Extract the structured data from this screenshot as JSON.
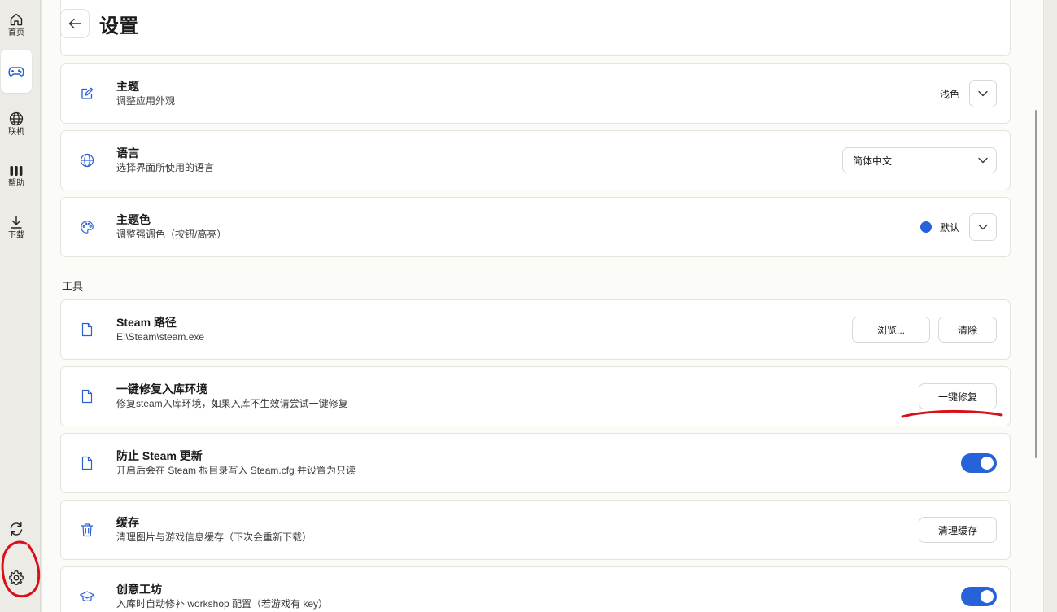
{
  "sidebar": {
    "items": [
      {
        "label": "首页",
        "icon": "home-icon"
      },
      {
        "label": "",
        "icon": "gamepad-icon",
        "active": true
      },
      {
        "label": "联机",
        "icon": "globe-icon"
      },
      {
        "label": "帮助",
        "icon": "help-bars-icon"
      },
      {
        "label": "下载",
        "icon": "download-icon"
      }
    ],
    "bottom": [
      {
        "icon": "sync-icon"
      },
      {
        "icon": "gear-icon"
      }
    ]
  },
  "header": {
    "title": "设置"
  },
  "appearance": {
    "theme": {
      "title": "主题",
      "desc": "调整应用外观",
      "value": "浅色"
    },
    "language": {
      "title": "语言",
      "desc": "选择界面所使用的语言",
      "value": "简体中文"
    },
    "accent": {
      "title": "主题色",
      "desc": "调整强调色（按钮/高亮）",
      "value": "默认",
      "color": "#2662d9"
    }
  },
  "tools": {
    "section_label": "工具",
    "steam_path": {
      "title": "Steam 路径",
      "desc": "E:\\Steam\\steam.exe",
      "browse_label": "浏览...",
      "clear_label": "清除"
    },
    "repair": {
      "title": "一键修复入库环境",
      "desc": "修复steam入库环境，如果入库不生效请尝试一键修复",
      "button_label": "一键修复"
    },
    "block_update": {
      "title": "防止 Steam 更新",
      "desc": "开启后会在 Steam 根目录写入 Steam.cfg 并设置为只读",
      "enabled": true
    },
    "cache": {
      "title": "缓存",
      "desc": "清理图片与游戏信息缓存（下次会重新下载）",
      "button_label": "清理缓存"
    },
    "workshop": {
      "title": "创意工坊",
      "desc": "入库时自动修补 workshop 配置（若游戏有 key）",
      "enabled": true
    }
  },
  "colors": {
    "accent": "#2763d8",
    "annotation": "#d9101a"
  }
}
